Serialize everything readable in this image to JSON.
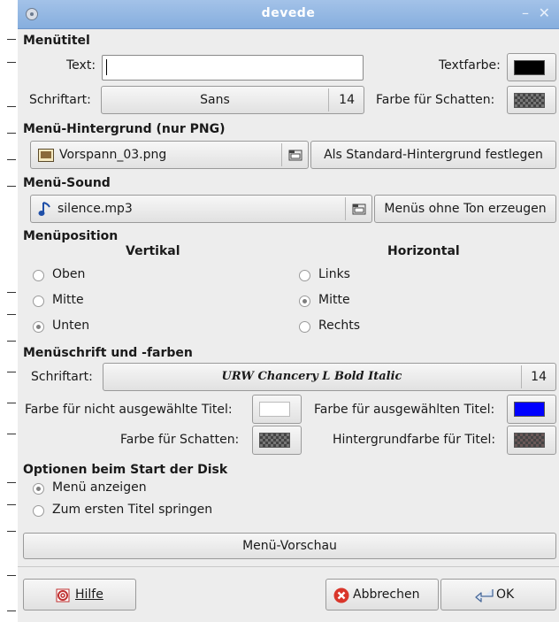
{
  "window": {
    "title": "devede"
  },
  "menu_title": {
    "section_label": "Menütitel",
    "text_label": "Text:",
    "text_value": "",
    "text_color_label": "Textfarbe:",
    "text_color": "#000000",
    "font_label": "Schriftart:",
    "font_name": "Sans",
    "font_size": "14",
    "shadow_color_label": "Farbe für Schatten:"
  },
  "background": {
    "section_label": "Menü-Hintergrund (nur PNG)",
    "file": "Vorspann_03.png",
    "default_button": "Als Standard-Hintergrund festlegen"
  },
  "sound": {
    "section_label": "Menü-Sound",
    "file": "silence.mp3",
    "silent_button": "Menüs ohne Ton erzeugen"
  },
  "position": {
    "section_label": "Menüposition",
    "vertical_label": "Vertikal",
    "horizontal_label": "Horizontal",
    "vertical_options": [
      "Oben",
      "Mitte",
      "Unten"
    ],
    "vertical_selected": "Unten",
    "horizontal_options": [
      "Links",
      "Mitte",
      "Rechts"
    ],
    "horizontal_selected": "Mitte"
  },
  "menu_font": {
    "section_label": "Menüschrift und -farben",
    "font_label": "Schriftart:",
    "font_name": "URW Chancery L Bold Italic",
    "font_size": "14",
    "unselected_label": "Farbe für nicht ausgewählte Titel:",
    "unselected_color": "#ffffff",
    "selected_label": "Farbe für ausgewählten Titel:",
    "selected_color": "#0000ff",
    "shadow_label": "Farbe für Schatten:",
    "title_bg_label": "Hintergrundfarbe für Titel:"
  },
  "startup": {
    "section_label": "Optionen beim Start der Disk",
    "options": [
      "Menü anzeigen",
      "Zum ersten Titel springen"
    ],
    "selected": "Menü anzeigen"
  },
  "preview_button": "Menü-Vorschau",
  "footer": {
    "help": "Hilfe",
    "cancel": "Abbrechen",
    "ok": "OK"
  }
}
